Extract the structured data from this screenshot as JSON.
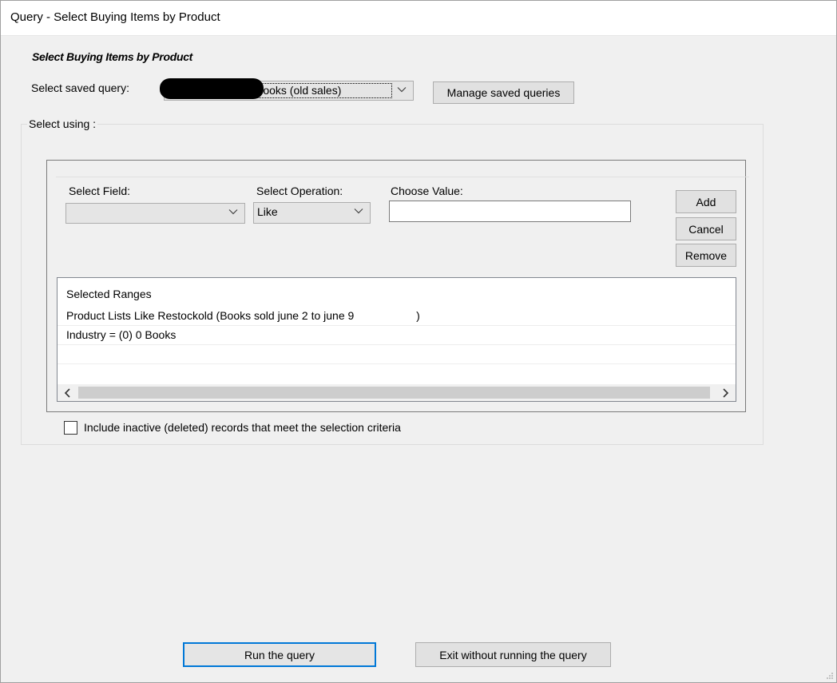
{
  "window": {
    "title": "Query - Select Buying Items by Product"
  },
  "form": {
    "heading": "Select Buying Items by Product",
    "saved_query_label": "Select saved query:",
    "saved_query_value": "Books (old sales)",
    "manage_button": "Manage saved queries",
    "select_using_label": "Select using :"
  },
  "criteria": {
    "field_label": "Select Field:",
    "field_value": "",
    "operation_label": "Select Operation:",
    "operation_value": "Like",
    "value_label": "Choose Value:",
    "value_input": "",
    "add_button": "Add",
    "cancel_button": "Cancel",
    "remove_button": "Remove"
  },
  "ranges": {
    "header": "Selected Ranges",
    "rows": [
      "Product Lists Like Restockold (Books sold june 2 to june 9                    )",
      "Industry = (0) 0 Books"
    ]
  },
  "options": {
    "include_inactive_label": "Include inactive (deleted) records that meet the selection criteria",
    "include_inactive_checked": false
  },
  "actions": {
    "run_button": "Run the query",
    "exit_button": "Exit without running the query"
  },
  "icons": {
    "dropdown": "chevron-down-icon",
    "scroll_left": "chevron-left-icon",
    "scroll_right": "chevron-right-icon",
    "resize_grip": "resize-grip-icon"
  },
  "colors": {
    "window_bg": "#f0f0f0",
    "button_bg": "#e1e1e1",
    "default_button_border": "#0078d7",
    "redaction": "#000000"
  }
}
